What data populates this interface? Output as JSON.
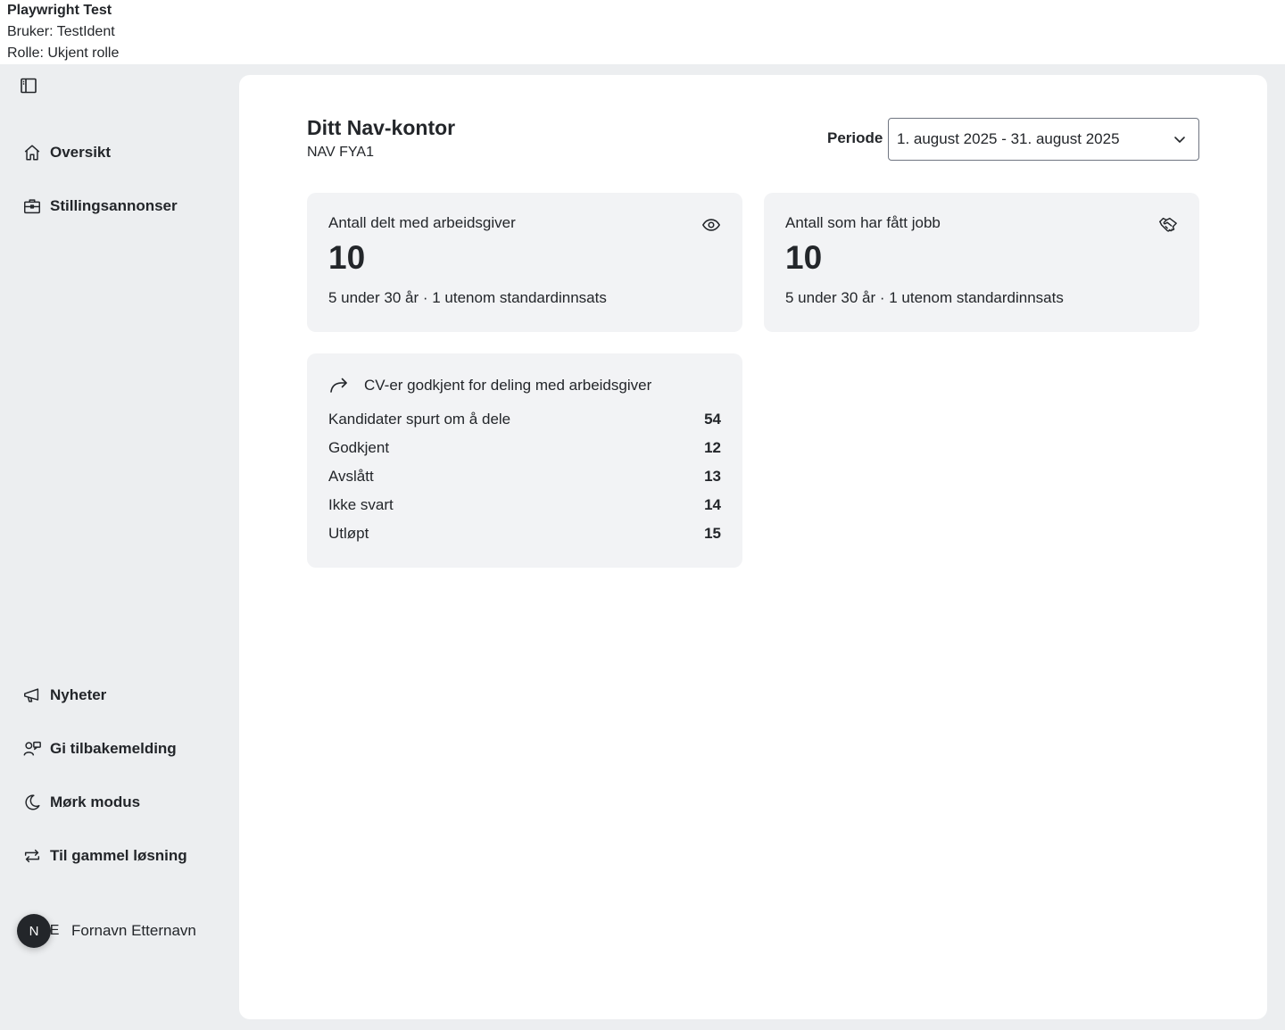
{
  "test_banner": {
    "title": "Playwright Test",
    "user": "Bruker: TestIdent",
    "role": "Rolle: Ukjent rolle"
  },
  "sidebar": {
    "toggle_icon": "sidebar-toggle-icon",
    "top_items": [
      {
        "label": "Oversikt",
        "icon": "house-icon"
      },
      {
        "label": "Stillingsannonser",
        "icon": "briefcase-icon"
      }
    ],
    "bottom_items": [
      {
        "label": "Nyheter",
        "icon": "megaphone-icon"
      },
      {
        "label": "Gi tilbakemelding",
        "icon": "feedback-icon"
      },
      {
        "label": "Mørk modus",
        "icon": "moon-icon"
      },
      {
        "label": "Til gammel løsning",
        "icon": "arrows-circle-icon"
      }
    ],
    "user": {
      "badge": "N",
      "initials": "FE",
      "name": "Fornavn Etternavn"
    }
  },
  "main": {
    "title": "Ditt Nav-kontor",
    "office": "NAV FYA1",
    "period": {
      "label": "Periode",
      "value": "1. august 2025 - 31. august 2025"
    },
    "cards": [
      {
        "title": "Antall delt med arbeidsgiver",
        "value": "10",
        "sub": "5 under 30 år · 1 utenom standardinnsats",
        "icon": "eye-icon"
      },
      {
        "title": "Antall som har fått jobb",
        "value": "10",
        "sub": "5 under 30 år · 1 utenom standardinnsats",
        "icon": "handshake-icon"
      }
    ],
    "cv_card": {
      "title": "CV-er godkjent for deling med arbeidsgiver",
      "icon": "share-arrow-icon",
      "rows": [
        {
          "label": "Kandidater spurt om å dele",
          "value": "54"
        },
        {
          "label": "Godkjent",
          "value": "12"
        },
        {
          "label": "Avslått",
          "value": "13"
        },
        {
          "label": "Ikke svart",
          "value": "14"
        },
        {
          "label": "Utløpt",
          "value": "15"
        }
      ]
    }
  }
}
